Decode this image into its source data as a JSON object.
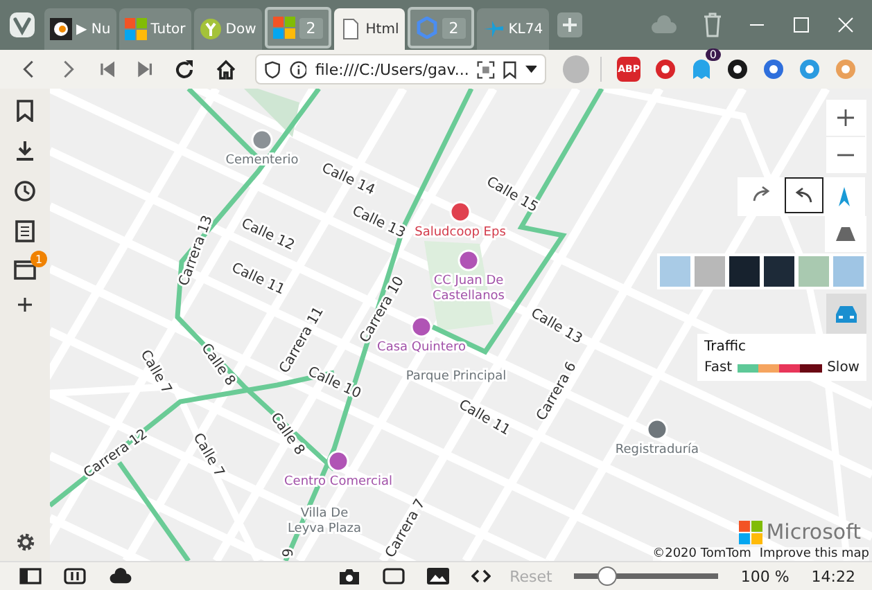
{
  "tabs": [
    {
      "title": "▶ Nu",
      "kind": "tab",
      "selected": false
    },
    {
      "title": "Tutor",
      "kind": "tab",
      "selected": false
    },
    {
      "title": "Dow",
      "kind": "tab",
      "selected": false
    },
    {
      "kind": "stack",
      "count": "2",
      "selected": false
    },
    {
      "title": "Html",
      "kind": "tab",
      "selected": true
    },
    {
      "kind": "stack",
      "count": "2",
      "selected": false
    },
    {
      "title": "KL74",
      "kind": "tab",
      "selected": false
    }
  ],
  "address": {
    "value": "file:///C:/Users/gav..."
  },
  "extensions": [
    {
      "kind": "abp",
      "label": "ABP"
    },
    {
      "kind": "plain"
    },
    {
      "kind": "badge",
      "badge": "0"
    },
    {
      "kind": "plain"
    },
    {
      "kind": "plain"
    },
    {
      "kind": "plain"
    },
    {
      "kind": "plain"
    }
  ],
  "sidebar": {
    "badge": "1"
  },
  "map": {
    "streets": [
      {
        "name": "Calle 14"
      },
      {
        "name": "Calle 15"
      },
      {
        "name": "Carrera 13"
      },
      {
        "name": "Calle 12"
      },
      {
        "name": "Calle 13"
      },
      {
        "name": "Calle 11"
      },
      {
        "name": "Carrera 10"
      },
      {
        "name": "Calle 13"
      },
      {
        "name": "Carrera 11"
      },
      {
        "name": "Calle 8"
      },
      {
        "name": "Calle 7"
      },
      {
        "name": "Calle 10"
      },
      {
        "name": "Calle 11"
      },
      {
        "name": "Carrera 6"
      },
      {
        "name": "Carrera 12"
      },
      {
        "name": "Calle 8"
      },
      {
        "name": "Calle 7"
      },
      {
        "name": "Carrera 7"
      },
      {
        "name": "9"
      }
    ],
    "pois": [
      {
        "kind": "cemetery",
        "lines": [
          "Cementerio"
        ]
      },
      {
        "kind": "hospital",
        "lines": [
          "Saludcoop Eps"
        ]
      },
      {
        "kind": "shop",
        "lines": [
          "CC Juan De",
          "Castellanos"
        ]
      },
      {
        "kind": "shop",
        "lines": [
          "Casa Quintero"
        ]
      },
      {
        "kind": "park",
        "lines": [
          "Parque Principal"
        ]
      },
      {
        "kind": "shop",
        "lines": [
          "Centro Comercial"
        ]
      },
      {
        "kind": "park",
        "lines": [
          "Villa De",
          "Leyva Plaza"
        ]
      },
      {
        "kind": "government",
        "lines": [
          "Registraduría"
        ]
      }
    ],
    "traffic_on": true,
    "legend": {
      "title": "Traffic",
      "fast": "Fast",
      "slow": "Slow"
    },
    "logo": "Microsoft",
    "attribution": {
      "copyright": "©2020 TomTom",
      "link": "Improve this map"
    }
  },
  "status": {
    "reset": "Reset",
    "reset_disabled": true,
    "zoom_slider": {
      "level": 0.2
    },
    "zoom": "100 %",
    "time": "14:22"
  }
}
